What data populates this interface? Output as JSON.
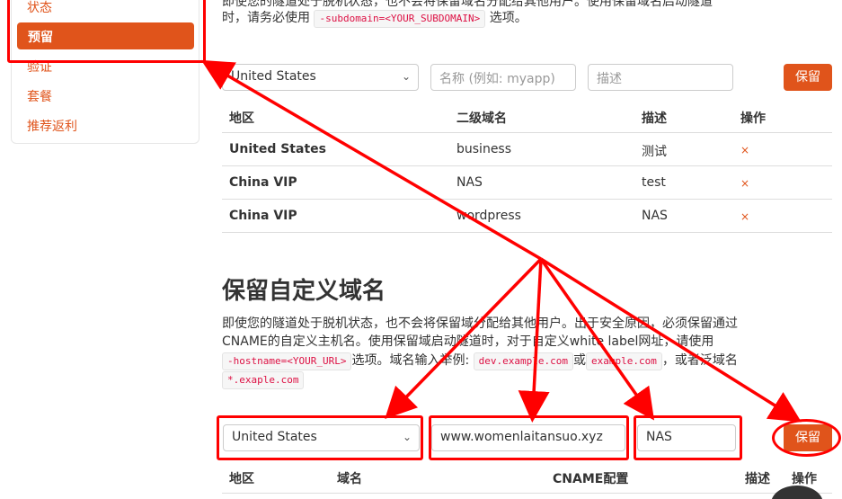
{
  "sidebar": {
    "items": [
      {
        "label": "状态",
        "active": false
      },
      {
        "label": "预留",
        "active": true
      },
      {
        "label": "验证",
        "active": false
      },
      {
        "label": "套餐",
        "active": false
      },
      {
        "label": "推荐返利",
        "active": false
      }
    ]
  },
  "intro": {
    "line1": "即使您的隧道处于脱机状态，也不会将保留域名分配给其他用户。使用保留域名启动隧道",
    "line2_prefix": "时，请务必使用",
    "line2_code": "-subdomain=<YOUR_SUBDOMAIN>",
    "line2_suffix": "选项。"
  },
  "subdomain_form": {
    "region_value": "United States",
    "name_placeholder": "名称 (例如: myapp)",
    "desc_placeholder": "描述",
    "reserve_label": "保留"
  },
  "subdomain_table": {
    "headers": [
      "地区",
      "二级域名",
      "描述",
      "操作"
    ],
    "rows": [
      {
        "region": "United States",
        "subdomain": "business",
        "desc": "测试",
        "action": "×"
      },
      {
        "region": "China VIP",
        "subdomain": "NAS",
        "desc": "test",
        "action": "×"
      },
      {
        "region": "China VIP",
        "subdomain": "wordpress",
        "desc": "NAS",
        "action": "×"
      }
    ]
  },
  "custom_section": {
    "title": "保留自定义域名",
    "p1": "即使您的隧道处于脱机状态，也不会将保留域分配给其他用户。出于安全原因，必须保留通过",
    "p2": "CNAME的自定义主机名。使用保留域启动隧道时，对于自定义white label网址，请使用",
    "p3_code": "-hostname=<YOUR_URL>",
    "p3_mid": "选项。域名输入举例:",
    "p3_code2": "dev.example.com",
    "p3_or": "或",
    "p3_code3": "example.com",
    "p3_tail": "，或者泛域名",
    "p4_code": "*.exaple.com"
  },
  "custom_form": {
    "region_value": "United States",
    "domain_value": "www.womenlaitansuo.xyz",
    "desc_value": "NAS",
    "reserve_label": "保留"
  },
  "custom_table": {
    "headers": [
      "地区",
      "域名",
      "CNAME配置",
      "描述",
      "操作"
    ]
  },
  "colors": {
    "accent": "#e0541b",
    "annotation": "#ff0000"
  }
}
